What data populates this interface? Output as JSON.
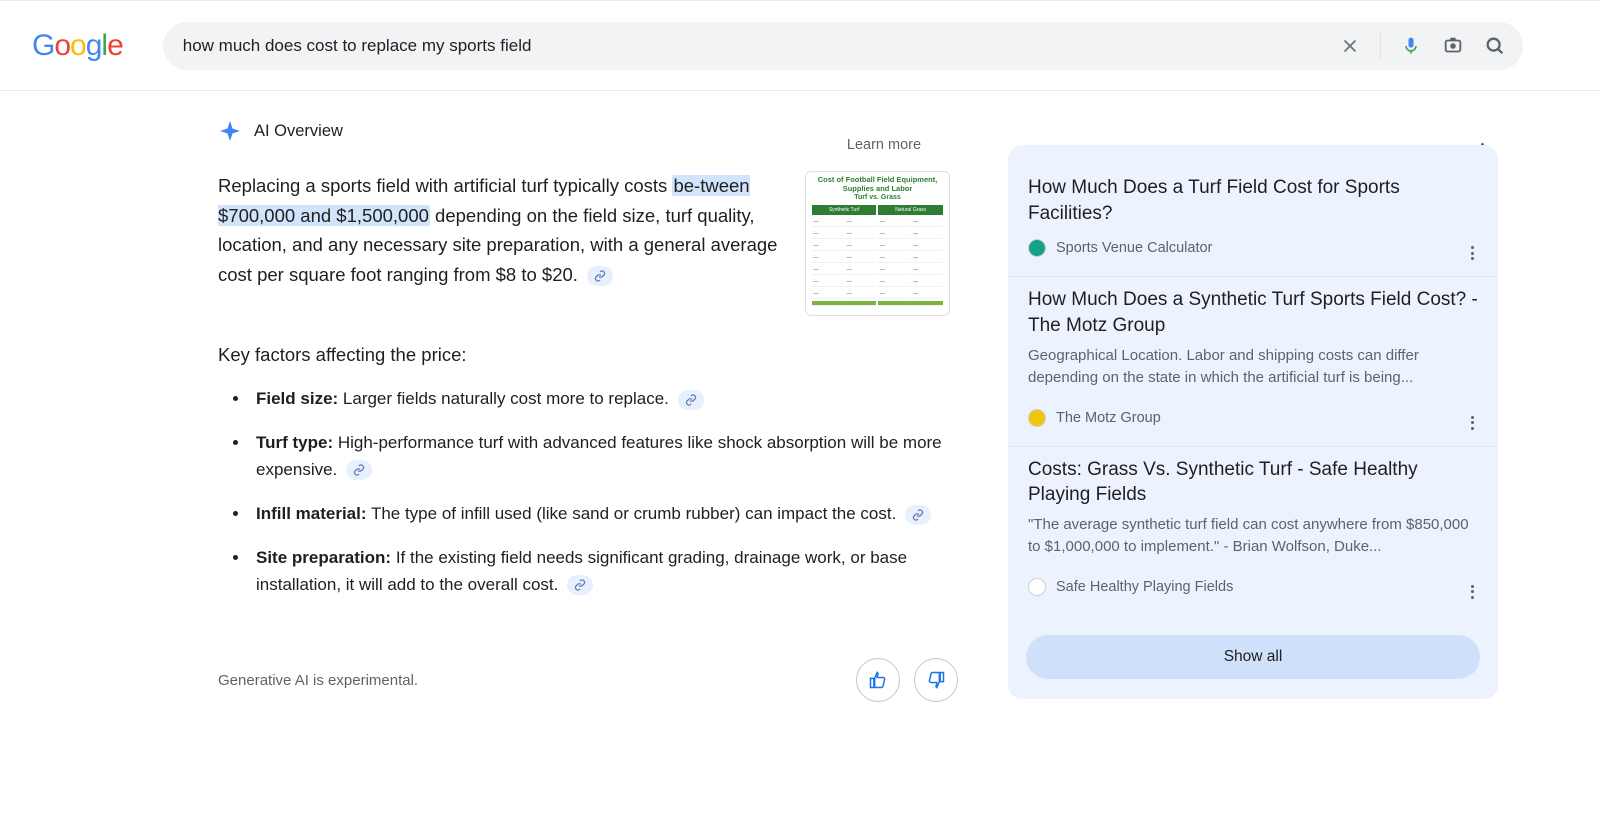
{
  "search": {
    "query": "how much does cost to replace my sports field"
  },
  "ai_overview": {
    "title": "AI Overview",
    "learn_more": "Learn more",
    "summary_pre": "Replacing a sports field with artificial turf typically costs ",
    "summary_hl": "be-tween $700,000 and $1,500,000",
    "summary_post": " depending on the field size, turf quality, location, and any necessary site preparation, with a general average cost per square foot ranging from $8 to $20.",
    "key_factors_heading": "Key factors affecting the price:",
    "factors": [
      {
        "label": "Field size:",
        "text": " Larger fields naturally cost more to replace."
      },
      {
        "label": "Turf type:",
        "text": " High-performance turf with advanced features like shock absorption will be more expensive."
      },
      {
        "label": "Infill material:",
        "text": " The type of infill used (like sand or crumb rubber) can impact the cost."
      },
      {
        "label": "Site preparation:",
        "text": " If the existing field needs significant grading, drainage work, or base installation, it will add to the overall cost."
      }
    ],
    "thumbnail": {
      "title": "Cost of Football Field Equipment, Supplies and Labor",
      "subtitle": "Turf vs. Grass",
      "col1": "Synthetic Turf",
      "col2": "Natural Grass"
    },
    "disclaimer": "Generative AI is experimental."
  },
  "sources": {
    "items": [
      {
        "title": "How Much Does a Turf Field Cost for Sports Facilities?",
        "snippet": "",
        "site": "Sports Venue Calculator",
        "fav_bg": "#16a085",
        "fav_fg": "#fff"
      },
      {
        "title": "How Much Does a Synthetic Turf Sports Field Cost? - The Motz Group",
        "snippet": "Geographical Location. Labor and shipping costs can differ depending on the state in which the artificial turf is being...",
        "site": "The Motz Group",
        "fav_bg": "#f1c40f",
        "fav_fg": "#fff"
      },
      {
        "title": "Costs: Grass Vs. Synthetic Turf - Safe Healthy Playing Fields",
        "snippet": "\"The average synthetic turf field can cost anywhere from $850,000 to $1,000,000 to implement.\" - Brian Wolfson, Duke...",
        "site": "Safe Healthy Playing Fields",
        "fav_bg": "#ffffff",
        "fav_fg": "#2ecc71"
      }
    ],
    "show_all": "Show all"
  }
}
